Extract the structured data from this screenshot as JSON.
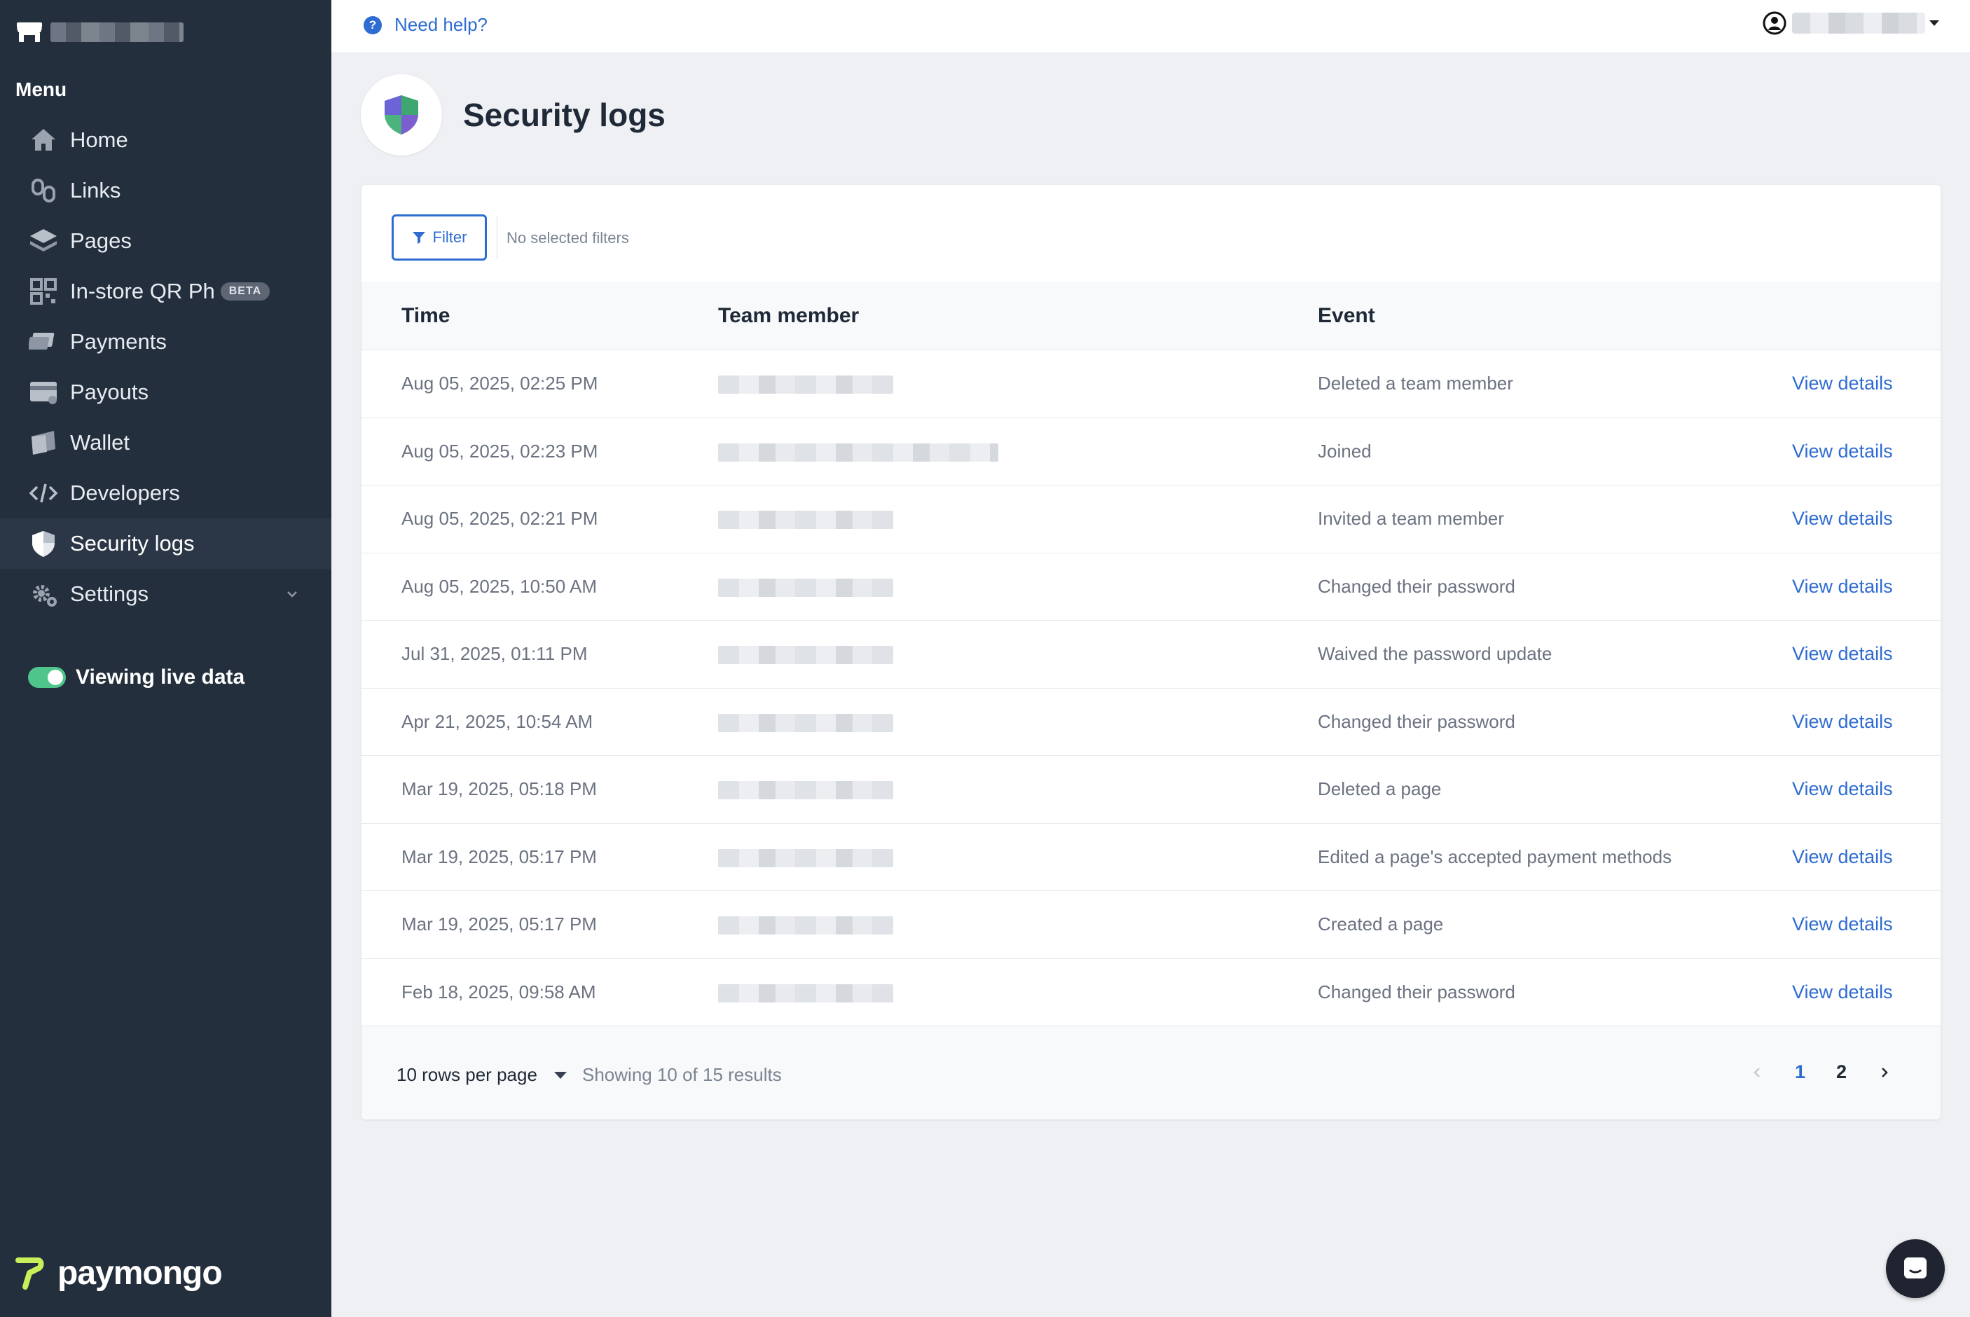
{
  "sidebar": {
    "menu_title": "Menu",
    "items": [
      {
        "label": "Home",
        "icon": "home-icon"
      },
      {
        "label": "Links",
        "icon": "links-icon"
      },
      {
        "label": "Pages",
        "icon": "pages-icon"
      },
      {
        "label": "In-store QR Ph",
        "icon": "qr-icon",
        "badge": "BETA"
      },
      {
        "label": "Payments",
        "icon": "payments-icon"
      },
      {
        "label": "Payouts",
        "icon": "payouts-icon"
      },
      {
        "label": "Wallet",
        "icon": "wallet-icon"
      },
      {
        "label": "Developers",
        "icon": "code-icon"
      },
      {
        "label": "Security logs",
        "icon": "shield-icon",
        "active": true
      },
      {
        "label": "Settings",
        "icon": "gear-icon"
      }
    ],
    "live_label": "Viewing live data",
    "live_on": true,
    "brand_logo": "paymongo"
  },
  "topbar": {
    "help_label": "Need help?"
  },
  "page": {
    "title": "Security logs"
  },
  "filters": {
    "button_label": "Filter",
    "status": "No selected filters"
  },
  "table": {
    "columns": [
      "Time",
      "Team member",
      "Event"
    ],
    "link_label": "View details",
    "rows": [
      {
        "time": "Aug 05, 2025, 02:25 PM",
        "event": "Deleted a team member"
      },
      {
        "time": "Aug 05, 2025, 02:23 PM",
        "event": "Joined"
      },
      {
        "time": "Aug 05, 2025, 02:21 PM",
        "event": "Invited a team member"
      },
      {
        "time": "Aug 05, 2025, 10:50 AM",
        "event": "Changed their password"
      },
      {
        "time": "Jul 31, 2025, 01:11 PM",
        "event": "Waived the password update"
      },
      {
        "time": "Apr 21, 2025, 10:54 AM",
        "event": "Changed their password"
      },
      {
        "time": "Mar 19, 2025, 05:18 PM",
        "event": "Deleted a page"
      },
      {
        "time": "Mar 19, 2025, 05:17 PM",
        "event": "Edited a page's accepted payment methods"
      },
      {
        "time": "Mar 19, 2025, 05:17 PM",
        "event": "Created a page"
      },
      {
        "time": "Feb 18, 2025, 09:58 AM",
        "event": "Changed their password"
      }
    ]
  },
  "footer": {
    "rows_per_page": "10 rows per page",
    "showing": "Showing 10 of 15 results",
    "pages": [
      "1",
      "2"
    ],
    "current_page": "1"
  },
  "colors": {
    "sidebar_bg": "#242f3e",
    "accent": "#2f6cd1",
    "toggle_on": "#4fc58b",
    "brand_green": "#c8f05a"
  }
}
